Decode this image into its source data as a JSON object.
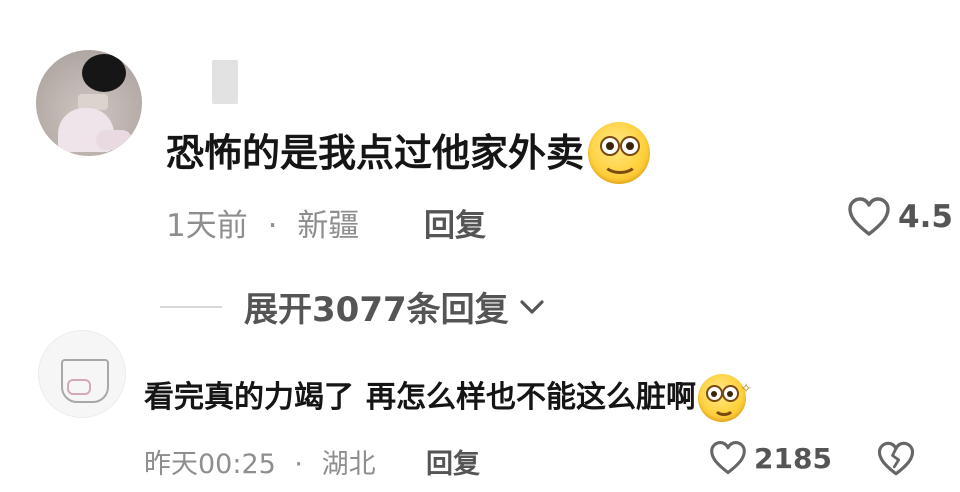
{
  "comments": [
    {
      "text": "恐怖的是我点过他家外卖",
      "emoji": "smiling-face-emoji",
      "time": "1天前",
      "separator": "·",
      "location": "新疆",
      "reply_label": "回复",
      "likes": "4.5"
    },
    {
      "text_part1": "看完真的力竭了",
      "text_part2": "再怎么样也不能这么脏啊",
      "emoji": "dizzy-face-emoji",
      "time": "昨天00:25",
      "separator": "·",
      "location": "湖北",
      "reply_label": "回复",
      "likes": "2185"
    }
  ],
  "expand_replies": {
    "label": "展开3077条回复"
  },
  "icons": {
    "like": "heart-outline-icon",
    "dislike": "broken-heart-icon",
    "expand": "chevron-down-icon"
  },
  "colors": {
    "text_primary": "#151515",
    "text_meta": "#8e8e8e",
    "text_action": "#555555"
  }
}
